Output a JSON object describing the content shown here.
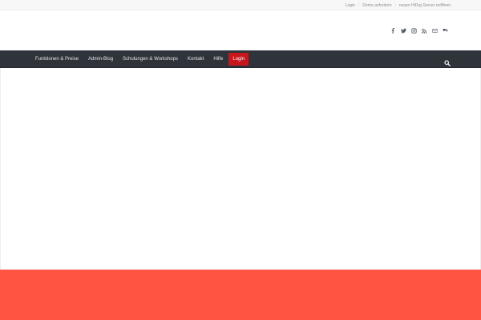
{
  "topbar": {
    "links": [
      "Login",
      "Demo anfordern",
      "neuen HiDrg-Server eröffnen"
    ]
  },
  "social": {
    "icons": [
      "facebook-icon",
      "twitter-icon",
      "instagram-icon",
      "rss-icon",
      "mail-icon",
      "chat-icon"
    ]
  },
  "nav": {
    "items": [
      "Funktionen & Preise",
      "Admin-Blog",
      "Schulungen & Workshops",
      "Kontakt",
      "Hilfe",
      "Login"
    ],
    "active_color": "#c8161d"
  },
  "colors": {
    "nav_bg": "#2f343b",
    "footer_band": "#ff5442"
  }
}
